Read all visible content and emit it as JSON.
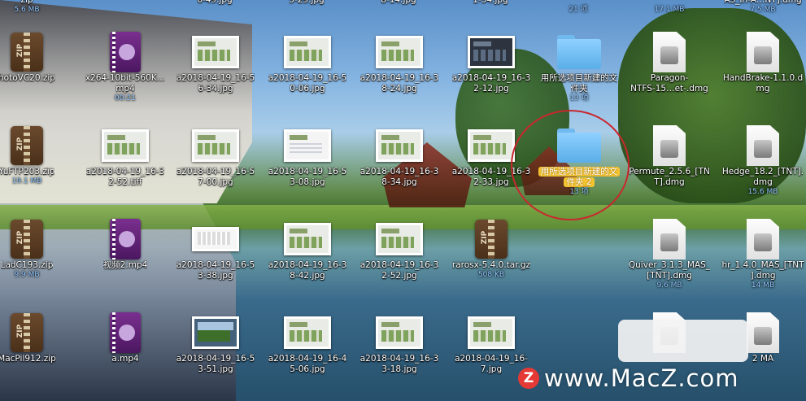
{
  "desktop": {
    "top_partial": [
      {
        "label": "zip",
        "sub": "5.6 MB"
      },
      {
        "label": "6-49.jpg",
        "sub": ""
      },
      {
        "label": "5-29.jpg",
        "sub": ""
      },
      {
        "label": "8-14.jpg",
        "sub": ""
      },
      {
        "label": "1-54.jpg",
        "sub": ""
      },
      {
        "label": "",
        "sub": "21 项"
      },
      {
        "label": "",
        "sub": "17.1 MB"
      },
      {
        "label": "AS_In-A…NT].dmg",
        "sub": "7.5 MB"
      }
    ],
    "rows": [
      [
        {
          "type": "zip",
          "icon": "zip-archive-icon",
          "l1": "hotoVC20.zip",
          "l2": "",
          "sub": ""
        },
        {
          "type": "video",
          "icon": "video-file-icon",
          "l1": "x264-10bit-560K…",
          "l2": "mp4",
          "sub": "00:21"
        },
        {
          "type": "thumb",
          "icon": "screenshot-thumbnail-icon",
          "l1": "a2018-04-19_16-5",
          "l2": "6-34.jpg",
          "sub": ""
        },
        {
          "type": "thumb",
          "icon": "screenshot-thumbnail-icon",
          "l1": "a2018-04-19_16-5",
          "l2": "0-06.jpg",
          "sub": ""
        },
        {
          "type": "thumb",
          "icon": "screenshot-thumbnail-icon",
          "l1": "a2018-04-19_16-3",
          "l2": "8-24.jpg",
          "sub": ""
        },
        {
          "type": "thumb-dark",
          "icon": "screenshot-thumbnail-icon",
          "l1": "a2018-04-19_16-3",
          "l2": "2-12.jpg",
          "sub": ""
        },
        {
          "type": "folder",
          "icon": "folder-icon",
          "l1": "用所选项目新建的文",
          "l2": "件夹",
          "sub": "13 项"
        },
        {
          "type": "dmg",
          "icon": "disk-image-icon",
          "l1": "Paragon-",
          "l2": "NTFS-15…et-.dmg",
          "sub": ""
        },
        {
          "type": "dmg",
          "icon": "disk-image-icon",
          "l1": "HandBrake-1.1.0.d",
          "l2": "mg",
          "sub": ""
        }
      ],
      [
        {
          "type": "zip",
          "icon": "zip-archive-icon",
          "l1": "YuFTP203.zip",
          "l2": "",
          "sub": "19.1 MB"
        },
        {
          "type": "thumb",
          "icon": "screenshot-thumbnail-icon",
          "l1": "a2018-04-19_16-3",
          "l2": "2-52.tiff",
          "sub": ""
        },
        {
          "type": "thumb",
          "icon": "screenshot-thumbnail-icon",
          "l1": "a2018-04-19_16-5",
          "l2": "7-00.jpg",
          "sub": ""
        },
        {
          "type": "thumb-win",
          "icon": "screenshot-thumbnail-icon",
          "l1": "a2018-04-19_16-5",
          "l2": "3-08.jpg",
          "sub": ""
        },
        {
          "type": "thumb",
          "icon": "screenshot-thumbnail-icon",
          "l1": "a2018-04-19_16-3",
          "l2": "8-34.jpg",
          "sub": ""
        },
        {
          "type": "thumb",
          "icon": "screenshot-thumbnail-icon",
          "l1": "a2018-04-19_16-3",
          "l2": "2-33.jpg",
          "sub": ""
        },
        {
          "type": "folder",
          "icon": "folder-icon",
          "l1": "用所选项目新建的文",
          "l2": "件夹 2",
          "sub": "13 项",
          "selected": true
        },
        {
          "type": "dmg",
          "icon": "disk-image-icon",
          "l1": "Permute_2.5.6_[TN",
          "l2": "T].dmg",
          "sub": ""
        },
        {
          "type": "dmg",
          "icon": "disk-image-icon",
          "l1": "Hedge_18.2_[TNT].",
          "l2": "dmg",
          "sub": "15.6 MB"
        }
      ],
      [
        {
          "type": "zip",
          "icon": "zip-archive-icon",
          "l1": "LadC193.zip",
          "l2": "",
          "sub": "9.9 MB"
        },
        {
          "type": "video",
          "icon": "video-file-icon",
          "l1": "视频2.mp4",
          "l2": "",
          "sub": ""
        },
        {
          "type": "thumb-kbd",
          "icon": "screenshot-thumbnail-icon",
          "l1": "a2018-04-19_16-5",
          "l2": "3-38.jpg",
          "sub": ""
        },
        {
          "type": "thumb",
          "icon": "screenshot-thumbnail-icon",
          "l1": "a2018-04-19_16-3",
          "l2": "8-42.jpg",
          "sub": ""
        },
        {
          "type": "thumb",
          "icon": "screenshot-thumbnail-icon",
          "l1": "a2018-04-19_16-3",
          "l2": "2-52.jpg",
          "sub": ""
        },
        {
          "type": "zip",
          "icon": "zip-archive-icon",
          "l1": "rarosx-5.4.0.tar.gz",
          "l2": "",
          "sub": "508 KB"
        },
        {
          "type": "dmg",
          "icon": "disk-image-icon",
          "l1": "Quiver_3.1.3_MAS_",
          "l2": "[TNT].dmg",
          "sub": "9.6 MB"
        },
        {
          "type": "dmg",
          "icon": "disk-image-icon",
          "l1": "hr_1.4.0_MAS_[TNT",
          "l2": "].dmg",
          "sub": "14 MB"
        }
      ],
      [
        {
          "type": "zip",
          "icon": "zip-archive-icon",
          "l1": "MacPil912.zip",
          "l2": "",
          "sub": ""
        },
        {
          "type": "video",
          "icon": "video-file-icon",
          "l1": "a.mp4",
          "l2": "",
          "sub": ""
        },
        {
          "type": "thumb-photo",
          "icon": "screenshot-thumbnail-icon",
          "l1": "a2018-04-19_16-5",
          "l2": "3-51.jpg",
          "sub": ""
        },
        {
          "type": "thumb",
          "icon": "screenshot-thumbnail-icon",
          "l1": "a2018-04-19_16-4",
          "l2": "5-06.jpg",
          "sub": ""
        },
        {
          "type": "thumb",
          "icon": "screenshot-thumbnail-icon",
          "l1": "a2018-04-19_16-3",
          "l2": "3-18.jpg",
          "sub": ""
        },
        {
          "type": "thumb",
          "icon": "screenshot-thumbnail-icon",
          "l1": "a2018-04-19_16-",
          "l2": "7.jpg",
          "sub": ""
        },
        {
          "type": "dmg",
          "icon": "disk-image-icon",
          "l1": "",
          "l2": "",
          "sub": ""
        },
        {
          "type": "dmg",
          "icon": "disk-image-icon",
          "l1": "2 MA",
          "l2": "",
          "sub": ""
        }
      ]
    ]
  },
  "watermark": {
    "logo": "Z",
    "text": "www.MacZ.com"
  },
  "colors": {
    "selection": "#f4c430",
    "annotation_circle": "#c8282e",
    "size_text": "#8fc6ff"
  }
}
